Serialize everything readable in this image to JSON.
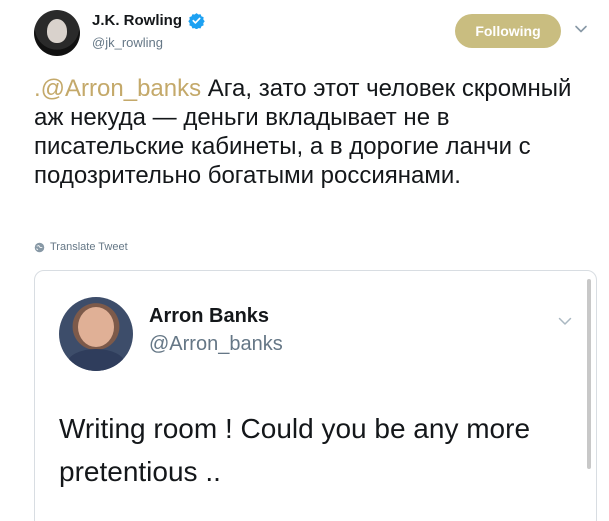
{
  "author": {
    "display_name": "J.K. Rowling",
    "handle": "@jk_rowling",
    "verified": true,
    "follow_label": "Following"
  },
  "tweet": {
    "mention": ".@Arron_banks",
    "text": " Ага, зато этот человек скромный аж некуда — деньги вкладывает не в писательские кабинеты, а в дорогие ланчи с подозрительно богатыми россиянами.",
    "translate_label": "Translate Tweet"
  },
  "quoted_tweet": {
    "display_name": "Arron Banks",
    "handle": "@Arron_banks",
    "text": "Writing room ! Could you be any more pretentious .."
  },
  "colors": {
    "follow_button": "#c9bd80",
    "mention": "#c4a96a",
    "verified": "#1da1f2",
    "secondary_text": "#657786"
  },
  "icons": {
    "verified": "verified-badge-icon",
    "chevron": "chevron-down-icon",
    "globe": "globe-icon"
  }
}
